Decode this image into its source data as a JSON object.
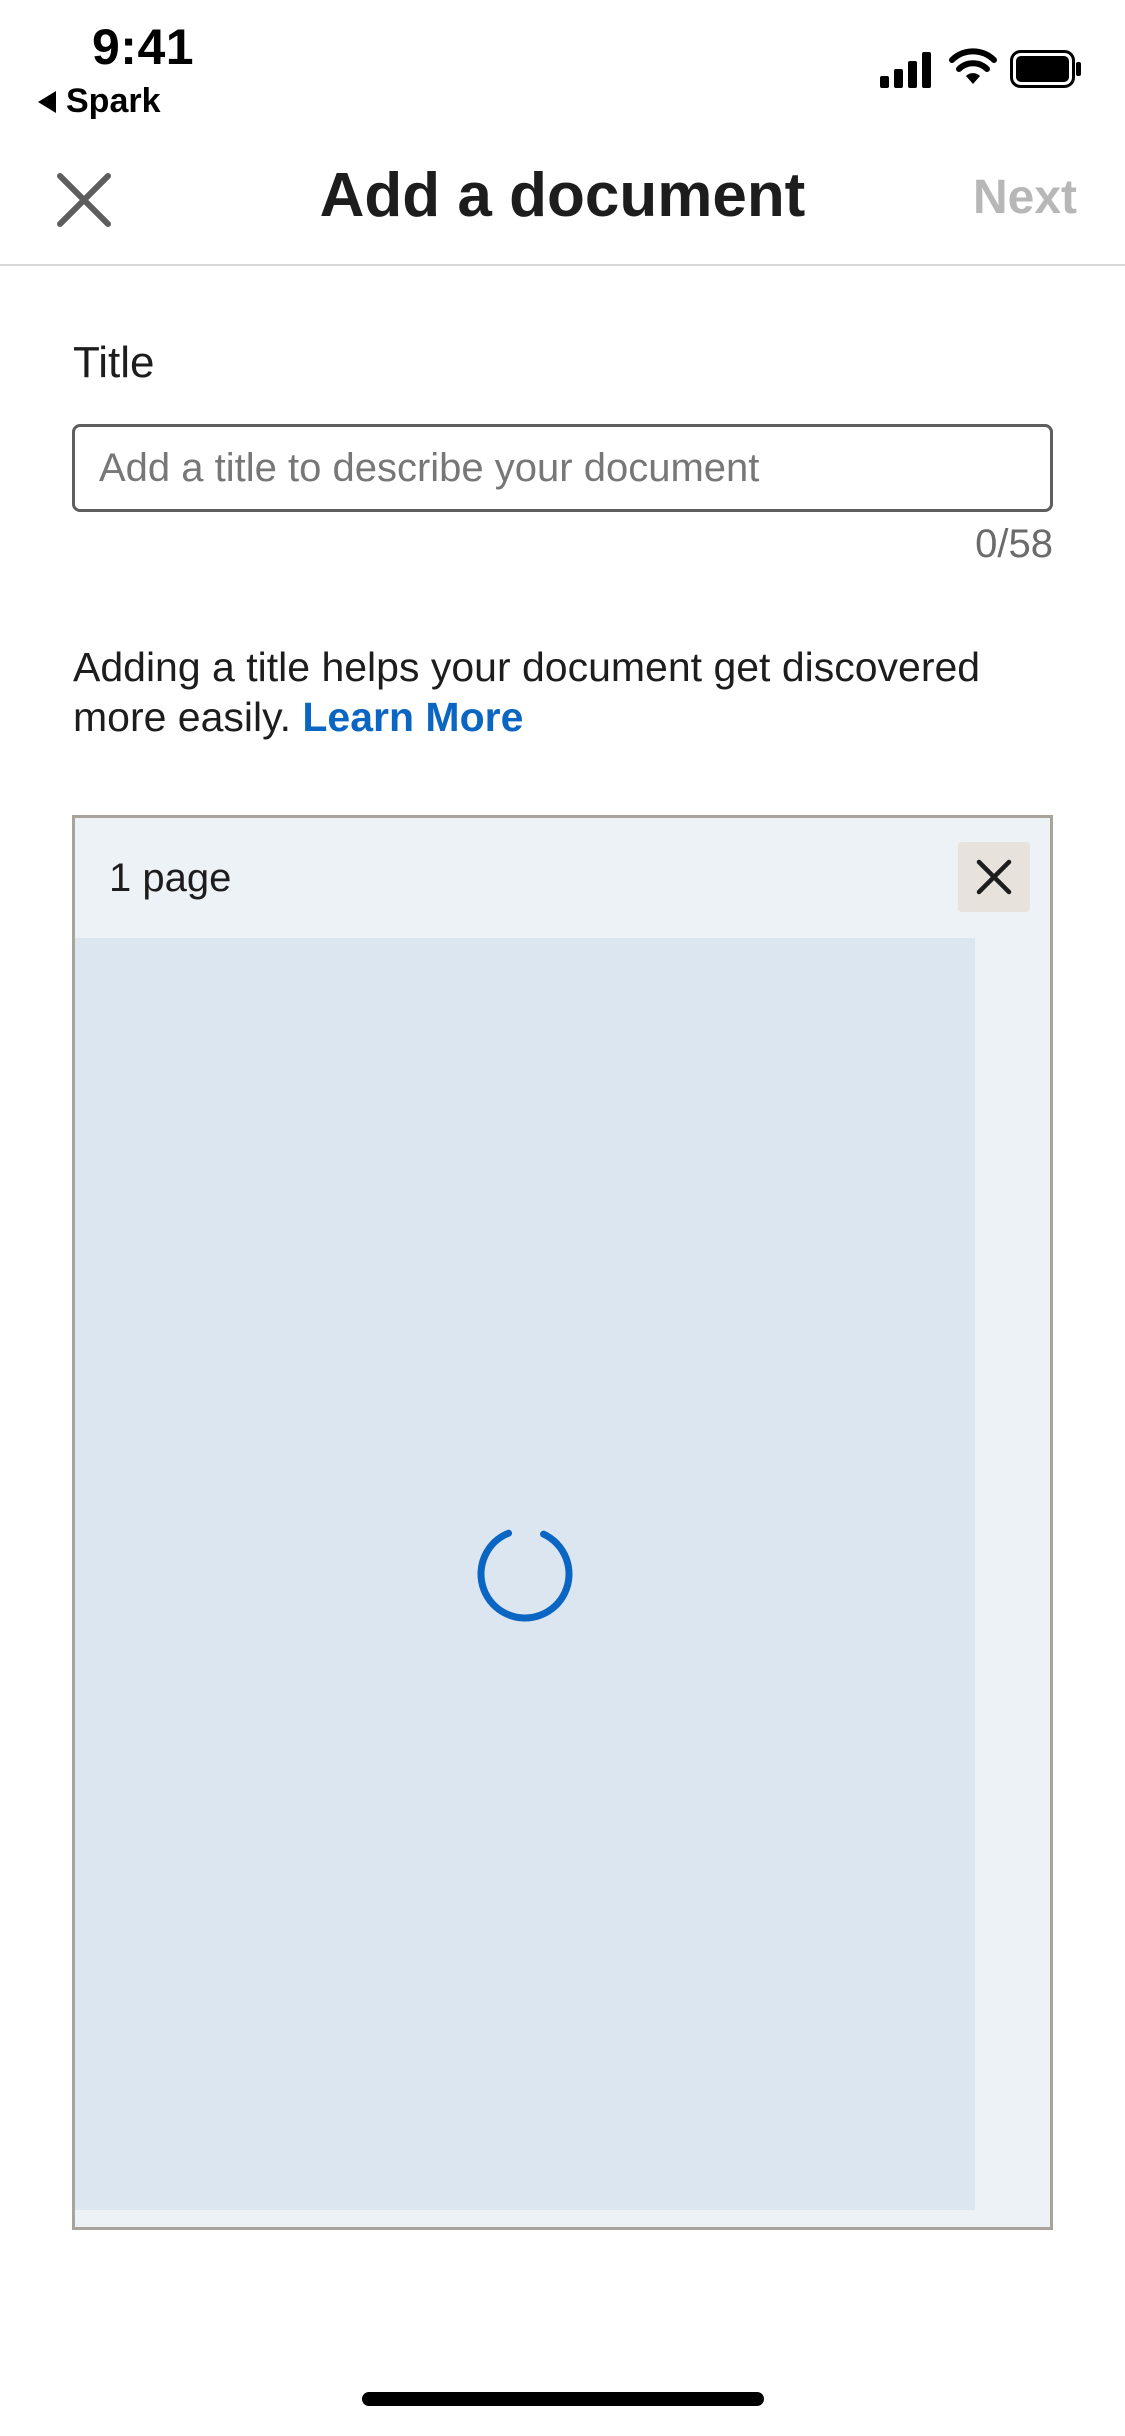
{
  "status_bar": {
    "time": "9:41",
    "back_app_label": "Spark",
    "icons": [
      "signal-icon",
      "wifi-icon",
      "battery-icon"
    ]
  },
  "header": {
    "title": "Add a document",
    "next_label": "Next",
    "close_icon": "close-icon"
  },
  "title_field": {
    "label": "Title",
    "value": "",
    "placeholder": "Add a title to describe your document",
    "counter": "0/58"
  },
  "helper": {
    "text": "Adding a title helps your document get discovered more easily.",
    "link_label": "Learn More"
  },
  "document": {
    "page_count_label": "1 page",
    "loading": true
  },
  "colors": {
    "accent": "#0a66c2",
    "disabled_text": "#b7b7b7",
    "card_bg": "#edf2f7",
    "preview_bg": "#dce6f0"
  }
}
